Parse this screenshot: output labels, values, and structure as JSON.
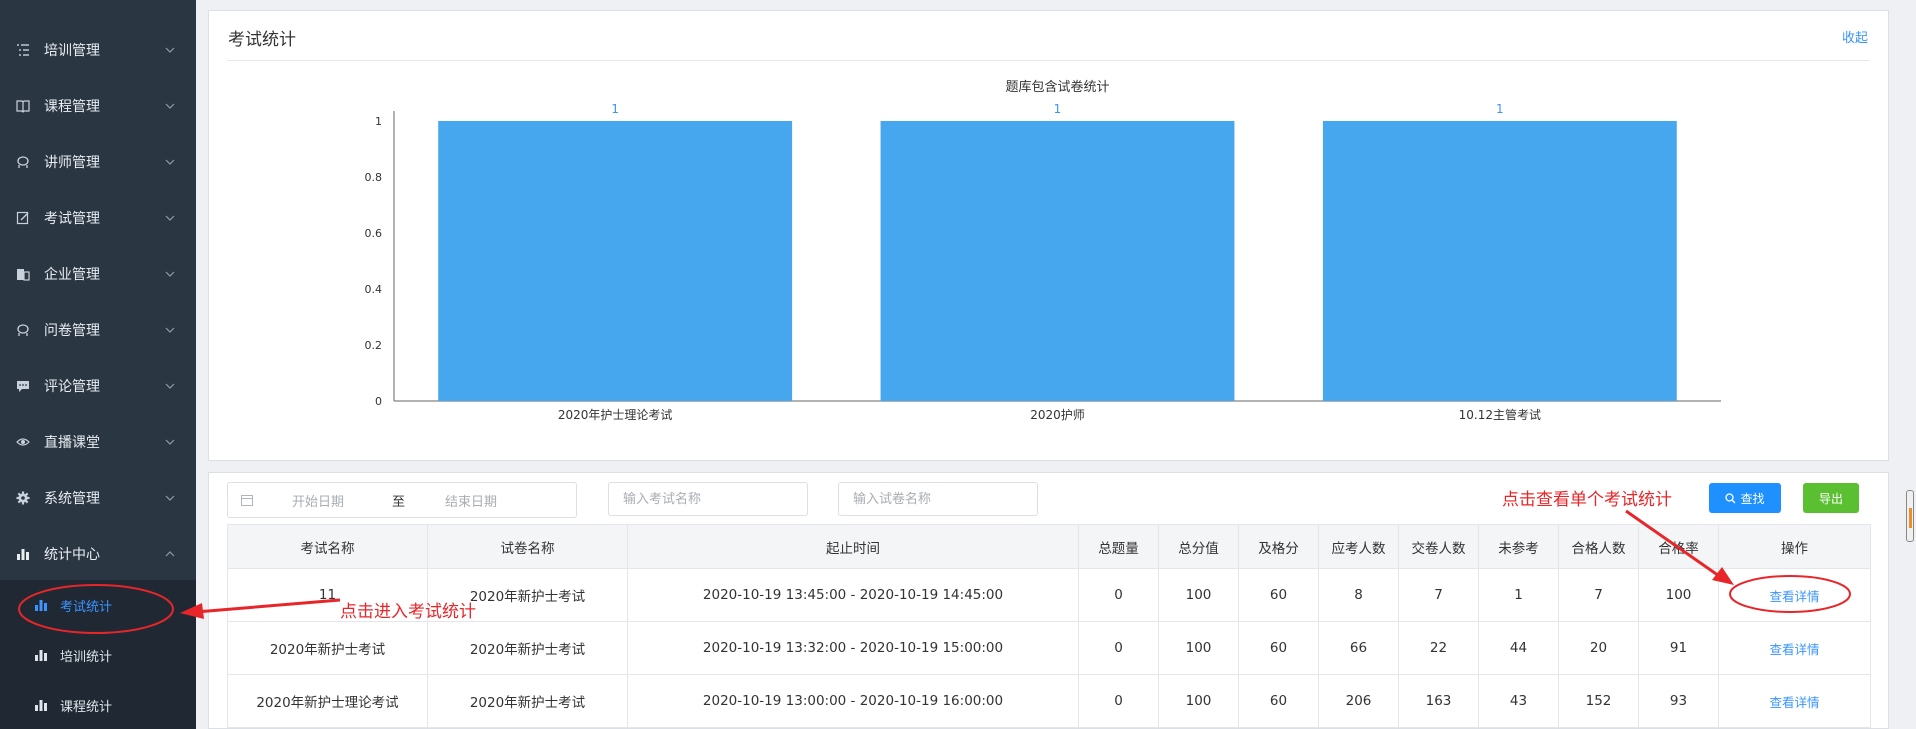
{
  "sidebar": {
    "items": [
      {
        "label": "培训管理",
        "icon": "list-icon"
      },
      {
        "label": "课程管理",
        "icon": "book-icon"
      },
      {
        "label": "讲师管理",
        "icon": "teacher-icon"
      },
      {
        "label": "考试管理",
        "icon": "edit-icon"
      },
      {
        "label": "企业管理",
        "icon": "building-icon"
      },
      {
        "label": "问卷管理",
        "icon": "survey-icon"
      },
      {
        "label": "评论管理",
        "icon": "comment-icon"
      },
      {
        "label": "直播课堂",
        "icon": "eye-icon"
      },
      {
        "label": "系统管理",
        "icon": "gear-icon"
      },
      {
        "label": "统计中心",
        "icon": "bar-chart-icon"
      }
    ],
    "submenu": [
      {
        "label": "考试统计",
        "active": true
      },
      {
        "label": "培训统计",
        "active": false
      },
      {
        "label": "课程统计",
        "active": false
      }
    ]
  },
  "stats_panel": {
    "title": "考试统计",
    "collapse_label": "收起"
  },
  "chart_data": {
    "type": "bar",
    "title": "题库包含试卷统计",
    "categories": [
      "2020年护士理论考试",
      "2020护师",
      "10.12主管考试"
    ],
    "values": [
      1,
      1,
      1
    ],
    "data_labels": [
      "1",
      "1",
      "1"
    ],
    "yticks": [
      "0",
      "0.2",
      "0.4",
      "0.6",
      "0.8",
      "1"
    ],
    "ylim": [
      0,
      1
    ],
    "bar_color": "#46a6ee",
    "label_color": "#3b95ff"
  },
  "filters": {
    "start_date_placeholder": "开始日期",
    "range_separator": "至",
    "end_date_placeholder": "结束日期",
    "exam_name_placeholder": "输入考试名称",
    "paper_name_placeholder": "输入试卷名称",
    "search_label": "查找",
    "export_label": "导出"
  },
  "table": {
    "headers": [
      "考试名称",
      "试卷名称",
      "起止时间",
      "总题量",
      "总分值",
      "及格分",
      "应考人数",
      "交卷人数",
      "未参考",
      "合格人数",
      "合格率",
      "操作"
    ],
    "rows": [
      {
        "exam": "11",
        "paper": "2020年新护士考试",
        "time": "2020-10-19 13:45:00 - 2020-10-19 14:45:00",
        "total_q": "0",
        "total_score": "100",
        "pass_score": "60",
        "expected": "8",
        "submitted": "7",
        "absent": "1",
        "passed": "7",
        "pass_rate": "100",
        "action": "查看详情"
      },
      {
        "exam": "2020年新护士考试",
        "paper": "2020年新护士考试",
        "time": "2020-10-19 13:32:00 - 2020-10-19 15:00:00",
        "total_q": "0",
        "total_score": "100",
        "pass_score": "60",
        "expected": "66",
        "submitted": "22",
        "absent": "44",
        "passed": "20",
        "pass_rate": "91",
        "action": "查看详情"
      },
      {
        "exam": "2020年新护士理论考试",
        "paper": "2020年新护士考试",
        "time": "2020-10-19 13:00:00 - 2020-10-19 16:00:00",
        "total_q": "0",
        "total_score": "100",
        "pass_score": "60",
        "expected": "206",
        "submitted": "163",
        "absent": "43",
        "passed": "152",
        "pass_rate": "93",
        "action": "查看详情"
      }
    ]
  },
  "annotations": {
    "enter_stats": "点击进入考试统计",
    "view_single": "点击查看单个考试统计",
    "color": "#e8262a"
  }
}
